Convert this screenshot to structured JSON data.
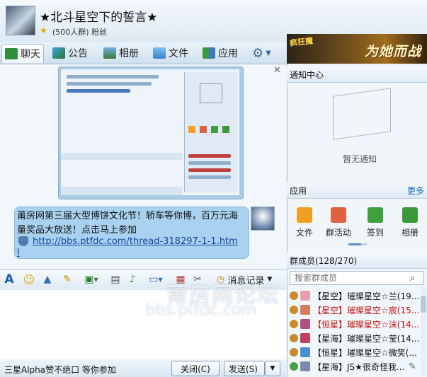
{
  "header": {
    "title": "★北斗星空下的誓言★",
    "subtitle": "(500人群) 粉丝"
  },
  "tabs": [
    {
      "label": "聊天"
    },
    {
      "label": "公告"
    },
    {
      "label": "相册"
    },
    {
      "label": "文件"
    },
    {
      "label": "应用"
    }
  ],
  "banner": {
    "left_text": "疯狂魔",
    "right_text": "为她而战"
  },
  "chat": {
    "message_text": "莆房网第三届大型博饼文化节！轿车等你博，百万元海量奖品大放送！点击马上参加",
    "link_text": "http://bbs.ptfdc.com/thread-318297-1-1.htm",
    "link_tail": "l"
  },
  "toolbar": {
    "history_label": "消息记录"
  },
  "bottom": {
    "status_text": "三星Alpha赞不绝口 等你参加",
    "close_label": "关闭(C)",
    "send_label": "发送(S)"
  },
  "right_panel": {
    "notice_title": "通知中心",
    "notice_empty": "暂无通知",
    "apps_title": "应用",
    "more_label": "更多",
    "apps": [
      {
        "label": "文件",
        "color": "#f0a020"
      },
      {
        "label": "群活动",
        "color": "#e06040"
      },
      {
        "label": "签到",
        "color": "#40a040"
      },
      {
        "label": "相册",
        "color": "#3a9a3a"
      }
    ],
    "members_title": "群成员(128/270)",
    "search_placeholder": "搜索群成员",
    "members": [
      {
        "name": "【星空】璀璨星空☆兰(19...",
        "color": "#111111"
      },
      {
        "name": "【星空】璀璨星空☆宸(15...",
        "color": "#cc1111"
      },
      {
        "name": "【恒星】璀璨星空☆沫(14...",
        "color": "#cc1111"
      },
      {
        "name": "【星海】璀璨星空☆莹(14...",
        "color": "#111111"
      },
      {
        "name": "【恒星】璀璨星空☆微笑(...",
        "color": "#111111"
      },
      {
        "name": "【星海】JS★很奇怪我...",
        "color": "#111111"
      }
    ]
  },
  "watermark": {
    "line1": "莆房网论坛",
    "line2": "bbs.ptfdc.com"
  }
}
